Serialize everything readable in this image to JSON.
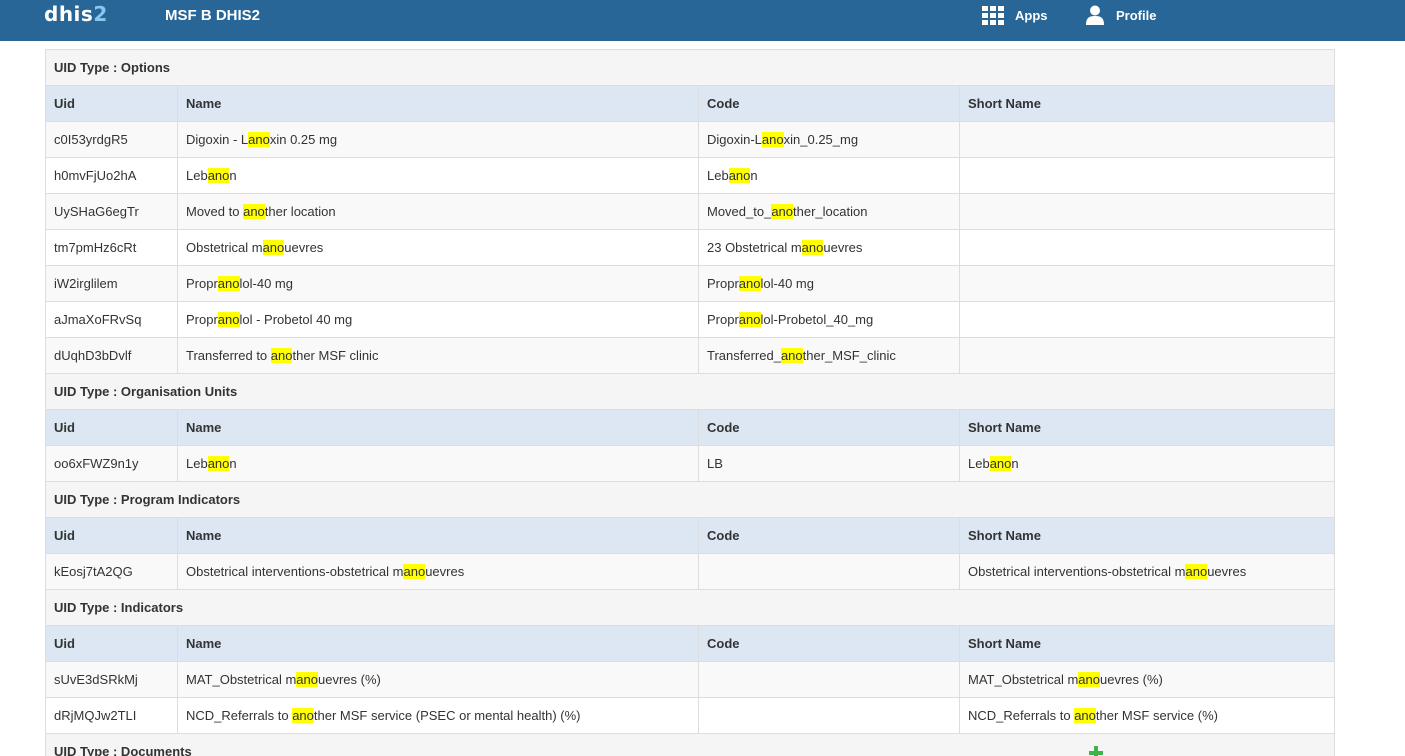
{
  "header": {
    "logo_text": "dhis",
    "logo_num": "2",
    "app_title": "MSF B DHIS2",
    "apps_label": "Apps",
    "profile_label": "Profile",
    "bar_color": "#276696"
  },
  "highlight": {
    "term": "ano",
    "color": "#ffff00"
  },
  "columns": [
    "Uid",
    "Name",
    "Code",
    "Short Name"
  ],
  "sections": [
    {
      "title": "UID Type : Options",
      "rows": [
        [
          "c0I53yrdgR5",
          "Digoxin - Lanoxin 0.25 mg",
          "Digoxin-Lanoxin_0.25_mg",
          ""
        ],
        [
          "h0mvFjUo2hA",
          "Lebanon",
          "Lebanon",
          ""
        ],
        [
          "UySHaG6egTr",
          "Moved to another location",
          "Moved_to_another_location",
          ""
        ],
        [
          "tm7pmHz6cRt",
          "Obstetrical manouevres",
          "23 Obstetrical manouevres",
          ""
        ],
        [
          "iW2irglilem",
          "Propranolol-40 mg",
          "Propranolol-40 mg",
          ""
        ],
        [
          "aJmaXoFRvSq",
          "Propranolol - Probetol 40 mg",
          "Propranolol-Probetol_40_mg",
          ""
        ],
        [
          "dUqhD3bDvlf",
          "Transferred to another MSF clinic",
          "Transferred_another_MSF_clinic",
          ""
        ]
      ]
    },
    {
      "title": "UID Type : Organisation Units",
      "rows": [
        [
          "oo6xFWZ9n1y",
          "Lebanon",
          "LB",
          "Lebanon"
        ]
      ]
    },
    {
      "title": "UID Type : Program Indicators",
      "rows": [
        [
          "kEosj7tA2QG",
          "Obstetrical interventions-obstetrical manouevres",
          "",
          "Obstetrical interventions-obstetrical manouevres"
        ]
      ]
    },
    {
      "title": "UID Type : Indicators",
      "rows": [
        [
          "sUvE3dSRkMj",
          "MAT_Obstetrical manouevres (%)",
          "",
          "MAT_Obstetrical manouevres (%)"
        ],
        [
          "dRjMQJw2TLI",
          "NCD_Referrals to another MSF service (PSEC or mental health) (%)",
          "",
          "NCD_Referrals to another MSF service (%)"
        ]
      ]
    },
    {
      "title": "UID Type : Documents",
      "rows": []
    }
  ]
}
